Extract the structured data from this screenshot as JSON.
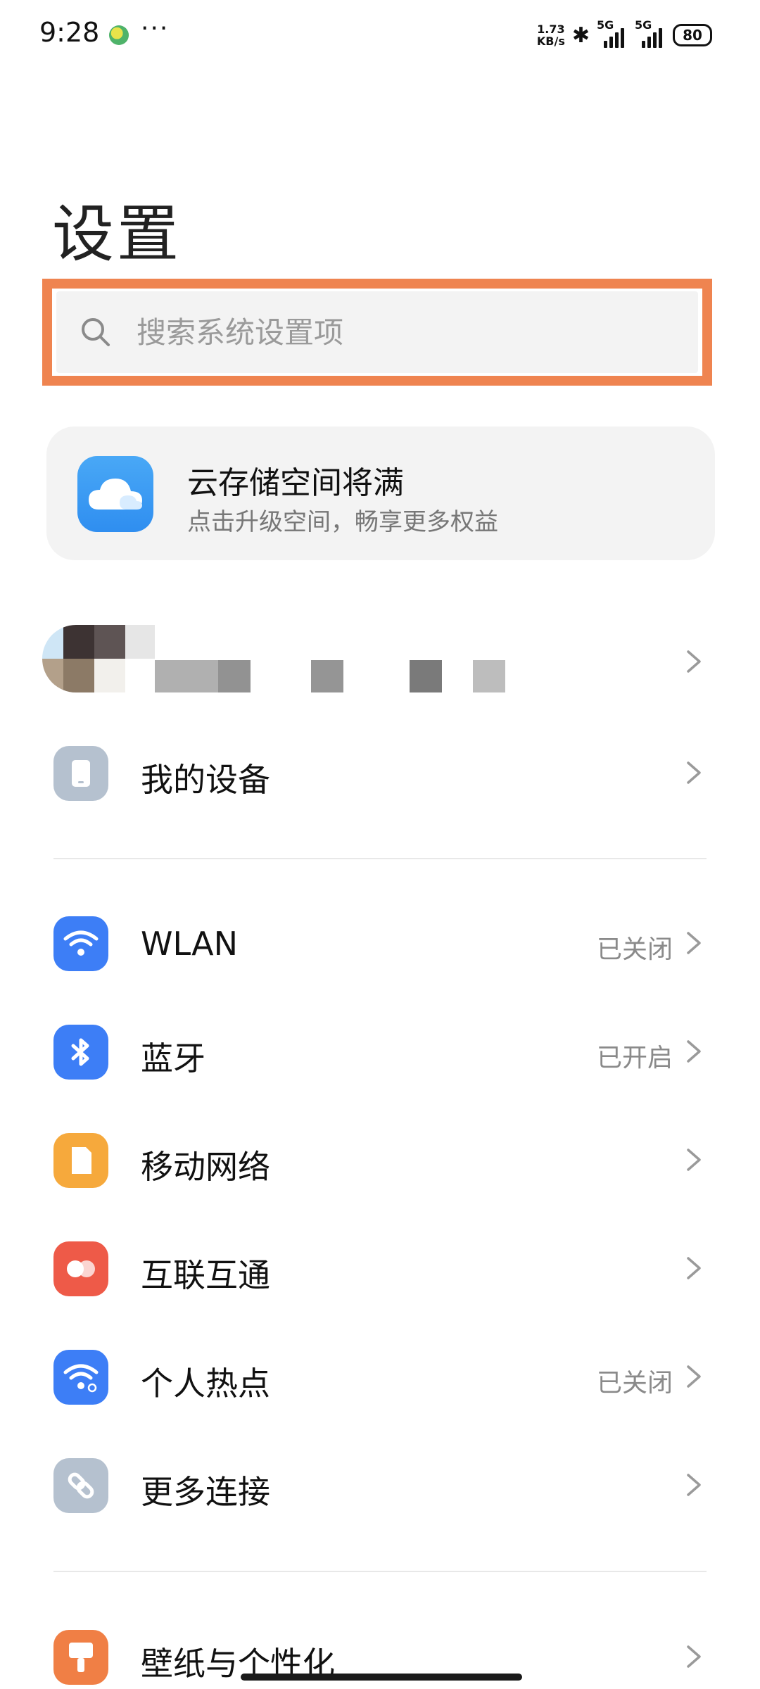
{
  "status_bar": {
    "time": "9:28",
    "more": "···",
    "net_speed_value": "1.73",
    "net_speed_unit": "KB/s",
    "signal1_label": "5G",
    "signal2_label": "5G",
    "battery": "80"
  },
  "page": {
    "title": "设置"
  },
  "search": {
    "placeholder": "搜索系统设置项",
    "value": ""
  },
  "cloud_card": {
    "title": "云存储空间将满",
    "subtitle": "点击升级空间，畅享更多权益"
  },
  "rows": [
    {
      "label": "我的设备",
      "status": "",
      "icon": "device-icon",
      "color": "#b5c1cf"
    },
    {
      "label": "WLAN",
      "status": "已关闭",
      "icon": "wifi-icon",
      "color": "#3d7ef6"
    },
    {
      "label": "蓝牙",
      "status": "已开启",
      "icon": "bluetooth-icon",
      "color": "#3d7ef6"
    },
    {
      "label": "移动网络",
      "status": "",
      "icon": "sim-card-icon",
      "color": "#f6a93c"
    },
    {
      "label": "互联互通",
      "status": "",
      "icon": "connect-icon",
      "color": "#ee5a48"
    },
    {
      "label": "个人热点",
      "status": "已关闭",
      "icon": "hotspot-icon",
      "color": "#3d7ef6"
    },
    {
      "label": "更多连接",
      "status": "",
      "icon": "link-icon",
      "color": "#b5c1cf"
    },
    {
      "label": "壁纸与个性化",
      "status": "",
      "icon": "paint-brush-icon",
      "color": "#f07f45"
    }
  ],
  "colors": {
    "highlight": "#ef8450",
    "accent_blue": "#3d7ef6",
    "card_bg": "#f3f3f3"
  }
}
